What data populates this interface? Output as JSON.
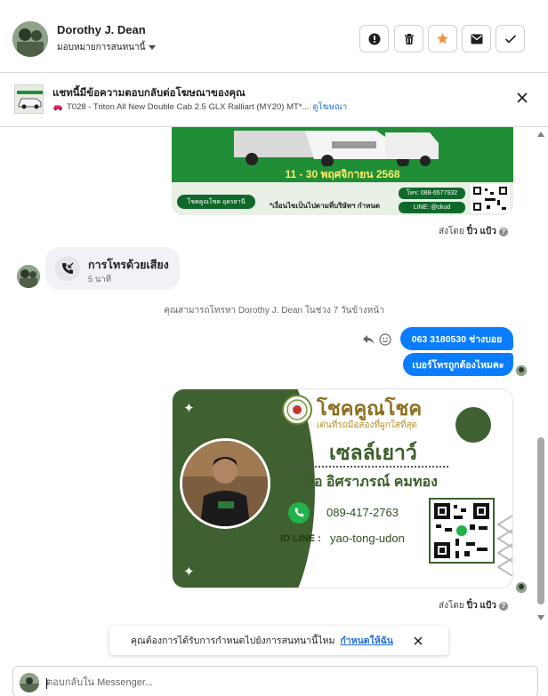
{
  "header": {
    "contact_name": "Dorothy J. Dean",
    "assign_label": "มอบหมายการสนทนานี้",
    "buttons": [
      {
        "name": "spam-button",
        "icon": "alert-icon"
      },
      {
        "name": "delete-button",
        "icon": "trash-icon"
      },
      {
        "name": "star-button",
        "icon": "star-icon"
      },
      {
        "name": "mark-unread-button",
        "icon": "mail-icon"
      },
      {
        "name": "done-button",
        "icon": "check-icon"
      }
    ]
  },
  "banner": {
    "title": "แชทนี้มีข้อความตอบกลับต่อโฆษณาของคุณ",
    "ad_name": "T028 - Triton All New Double Cab 2.5 GLX Ralliart (MY20) MT*...",
    "view_ad": "ดูโฆษณา"
  },
  "ad_image": {
    "date_text": "11 - 30 พฤศจิกายน 2568",
    "dealer": "โชคคูณโชค อุดรธานี",
    "note": "*เงื่อนไขเป็นไปตามที่บริษัทฯ กำหนด",
    "phone": "โทร: 088-6577932",
    "line": "LINE: @ckud"
  },
  "messages": {
    "sent_by_prefix": "ส่งโดย",
    "sent_by_name": "ปิ๋ว แป้ว",
    "call_title": "การโทรด้วยเสียง",
    "call_duration": "5 นาที",
    "call_notice": "คุณสามารถโทรหา Dorothy J. Dean ในช่วง 7 วันข้างหน้า",
    "outgoing": [
      "063 3180530 ช่างบอย",
      "เบอร์โทรถูกต้องไหมคะ"
    ]
  },
  "card": {
    "brand": "โชคคูณโชค",
    "tagline": "เด่นที่รถมือสองที่ผูกใสที่สุด",
    "role": "เซลล์เยาว์",
    "person_name": "ชื่อ อิศราภรณ์ คมทอง",
    "phone": "089-417-2763",
    "id_line_label": "ID LINE :",
    "id_line": "yao-tong-udon"
  },
  "prompt": {
    "text": "คุณต้องการได้รับการกำหนดไปยังการสนทนานี้ไหม",
    "link": "กำหนดให้ฉัน"
  },
  "composer": {
    "placeholder": "ตอบกลับใน Messenger..."
  },
  "colors": {
    "accent_blue": "#0a7cff",
    "star_orange": "#f7923a",
    "link_blue": "#216fdb",
    "card_green": "#3f6030"
  }
}
